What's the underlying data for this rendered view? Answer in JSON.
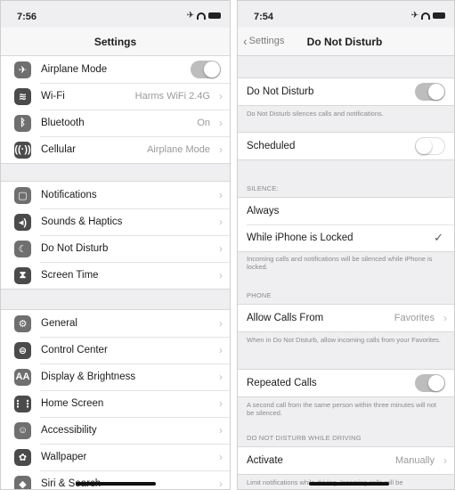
{
  "left": {
    "status": {
      "time": "7:56",
      "icons": "✈"
    },
    "nav": {
      "title": "Settings"
    },
    "group1": [
      {
        "label": "Airplane Mode",
        "icon": "airplane-icon",
        "glyph": "✈",
        "toggle": "on"
      },
      {
        "label": "Wi-Fi",
        "icon": "wifi-icon",
        "glyph": "≋",
        "value": "Harms WiFi 2.4G"
      },
      {
        "label": "Bluetooth",
        "icon": "bluetooth-icon",
        "glyph": "ᛒ",
        "value": "On"
      },
      {
        "label": "Cellular",
        "icon": "cellular-icon",
        "glyph": "((·))",
        "value": "Airplane Mode"
      }
    ],
    "group2": [
      {
        "label": "Notifications",
        "icon": "notifications-icon",
        "glyph": "▢"
      },
      {
        "label": "Sounds & Haptics",
        "icon": "speaker-icon",
        "glyph": "◂)"
      },
      {
        "label": "Do Not Disturb",
        "icon": "moon-icon",
        "glyph": "☾"
      },
      {
        "label": "Screen Time",
        "icon": "hourglass-icon",
        "glyph": "⧗"
      }
    ],
    "group3": [
      {
        "label": "General",
        "icon": "gear-icon",
        "glyph": "⚙"
      },
      {
        "label": "Control Center",
        "icon": "control-center-icon",
        "glyph": "⊜"
      },
      {
        "label": "Display & Brightness",
        "icon": "display-icon",
        "glyph": "AA"
      },
      {
        "label": "Home Screen",
        "icon": "home-screen-icon",
        "glyph": "⋮⋮"
      },
      {
        "label": "Accessibility",
        "icon": "accessibility-icon",
        "glyph": "☺"
      },
      {
        "label": "Wallpaper",
        "icon": "wallpaper-icon",
        "glyph": "✿"
      },
      {
        "label": "Siri & Search",
        "icon": "siri-icon",
        "glyph": "◆"
      }
    ]
  },
  "right": {
    "status": {
      "time": "7:54",
      "icons": "✈"
    },
    "nav": {
      "back": "Settings",
      "title": "Do Not Disturb"
    },
    "dnd": {
      "label": "Do Not Disturb",
      "toggle": "on",
      "footnote": "Do Not Disturb silences calls and notifications."
    },
    "scheduled": {
      "label": "Scheduled",
      "toggle": "off"
    },
    "silence": {
      "header": "SILENCE:",
      "always": "Always",
      "locked": "While iPhone is Locked",
      "check": "✓",
      "footnote": "Incoming calls and notifications will be silenced while iPhone is locked."
    },
    "phone": {
      "header": "PHONE",
      "allow_label": "Allow Calls From",
      "allow_value": "Favorites",
      "footnote": "When in Do Not Disturb, allow incoming calls from your Favorites."
    },
    "repeated": {
      "label": "Repeated Calls",
      "toggle": "on",
      "footnote": "A second call from the same person within three minutes will not be silenced."
    },
    "driving": {
      "header": "DO NOT DISTURB WHILE DRIVING",
      "activate_label": "Activate",
      "activate_value": "Manually",
      "footnote": "Limit notifications while driving. Incoming calls will be"
    }
  },
  "colors": {
    "background": "#efeff1",
    "row": "#ffffff",
    "toggle_on": "#bdbdbd",
    "secondary_text": "#9a9a9a"
  }
}
